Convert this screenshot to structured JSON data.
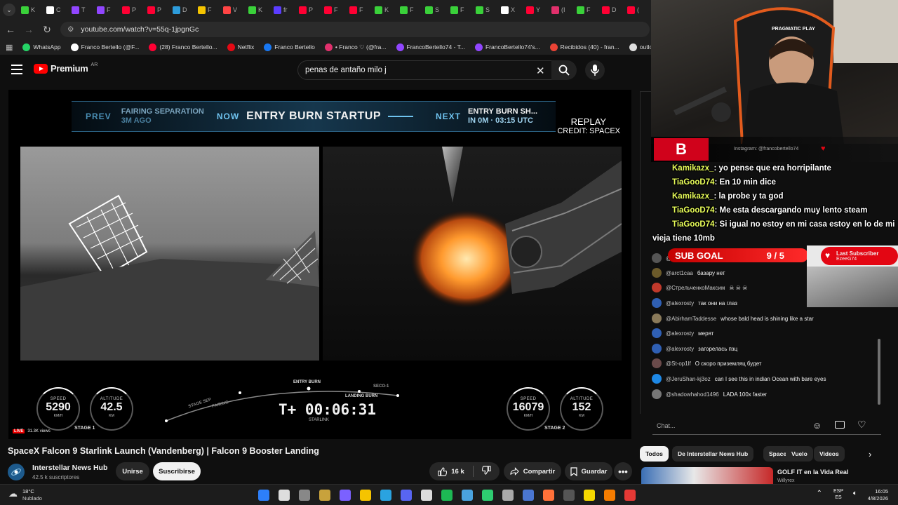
{
  "browser": {
    "tabs": [
      {
        "label": "K",
        "color": "#3ad13a"
      },
      {
        "label": "C",
        "color": "#ffffff"
      },
      {
        "label": "T",
        "color": "#9146ff"
      },
      {
        "label": "F",
        "color": "#9146ff"
      },
      {
        "label": "P",
        "color": "#ff0033"
      },
      {
        "label": "P",
        "color": "#ff0033"
      },
      {
        "label": "D",
        "color": "#2d9cdb"
      },
      {
        "label": "F",
        "color": "#f5c400"
      },
      {
        "label": "V",
        "color": "#ff4444"
      },
      {
        "label": "K",
        "color": "#3ad13a"
      },
      {
        "label": "fr",
        "color": "#5b3cff"
      },
      {
        "label": "P",
        "color": "#ff0033"
      },
      {
        "label": "F",
        "color": "#ff0033"
      },
      {
        "label": "F",
        "color": "#ff0033"
      },
      {
        "label": "K",
        "color": "#3ad13a"
      },
      {
        "label": "F",
        "color": "#3ad13a"
      },
      {
        "label": "S",
        "color": "#3ad13a"
      },
      {
        "label": "F",
        "color": "#3ad13a"
      },
      {
        "label": "S",
        "color": "#3ad13a"
      },
      {
        "label": "X",
        "color": "#ffffff"
      },
      {
        "label": "Y",
        "color": "#ff0033"
      },
      {
        "label": "(I",
        "color": "#e1306c"
      },
      {
        "label": "F",
        "color": "#3ad13a"
      },
      {
        "label": "D",
        "color": "#ff0033"
      },
      {
        "label": "(",
        "color": "#ff0033"
      }
    ],
    "url": "youtube.com/watch?v=55q-1jpgnGc",
    "bookmarks": [
      {
        "label": "WhatsApp",
        "color": "#25d366"
      },
      {
        "label": "Franco Bertello (@F...",
        "color": "#ffffff"
      },
      {
        "label": "(28) Franco Bertello...",
        "color": "#ff0033"
      },
      {
        "label": "Netflix",
        "color": "#e50914"
      },
      {
        "label": "Franco Bertello",
        "color": "#1877f2"
      },
      {
        "label": "• Franco ♡ (@fra...",
        "color": "#e1306c"
      },
      {
        "label": "FrancoBertello74 - T...",
        "color": "#9146ff"
      },
      {
        "label": "FrancoBertello74's...",
        "color": "#9146ff"
      },
      {
        "label": "Recibidos (40) - fran...",
        "color": "#ea4335"
      },
      {
        "label": "outlook",
        "color": "#dddddd"
      },
      {
        "label": "Alert",
        "color": "#3ad1a0"
      }
    ]
  },
  "youtube": {
    "brand": "Premium",
    "country": "AR",
    "search_query": "penas de antaño milo j",
    "video": {
      "timeline": {
        "prev_key": "PREV",
        "prev_event": "FAIRING SEPARATION",
        "prev_time": "3M AGO",
        "now_key": "NOW",
        "now_event": "ENTRY BURN STARTUP",
        "next_key": "NEXT",
        "next_event": "ENTRY BURN SH...",
        "next_time": "IN 0M · 03:15 UTC"
      },
      "replay": "REPLAY",
      "credit": "CREDIT: SPACEX",
      "stage1": {
        "speed": "5290",
        "altitude": "42.5",
        "speed_label": "SPEED",
        "altitude_label": "ALTITUDE",
        "speed_unit": "KM/H",
        "altitude_unit": "KM",
        "name": "STAGE 1"
      },
      "stage2": {
        "speed": "16079",
        "altitude": "152",
        "speed_label": "SPEED",
        "altitude_label": "ALTITUDE",
        "speed_unit": "KM/H",
        "altitude_unit": "KM",
        "name": "STAGE 2"
      },
      "timer": "T+ 00:06:31",
      "timer_label": "STARLINK",
      "events": [
        "ENTRY BURN",
        "LANDING BURN",
        "SECO-1",
        "STAGE SEP",
        "FAIRING"
      ],
      "live_label": "LIVE",
      "viewers": "31.3K views"
    },
    "title": "SpaceX Falcon 9 Starlink Launch (Vandenberg) | Falcon 9 Booster Landing",
    "channel": {
      "name": "Interstellar News Hub",
      "subs": "42.5 k suscriptores",
      "join": "Unirse",
      "subscribe": "Suscribirse"
    },
    "actions": {
      "likes": "16 k",
      "share": "Compartir",
      "save": "Guardar"
    },
    "chips": [
      "Todos",
      "De Interstellar News Hub",
      "SpaceX",
      "Vuelo",
      "Videos"
    ],
    "recommended": {
      "title": "GOLF IT en la Vida Real",
      "channel": "Willyrex"
    }
  },
  "chat": {
    "placeholder": "Chat...",
    "messages": [
      {
        "author": "@Franklinalex",
        "text": "так вопрос вновь - как они скоро",
        "color": "#555555"
      },
      {
        "author": "@arct1caa",
        "text": "базару нет",
        "color": "#6b5a2a"
      },
      {
        "author": "@СтрельченкоМаксим",
        "text": "☠ ☠ ☠",
        "color": "#c0392b"
      },
      {
        "author": "@alexrosty",
        "text": "так они на глаз",
        "color": "#2f5fb3"
      },
      {
        "author": "@AbirhamTaddesse",
        "text": "whose bald head is shining like a star",
        "color": "#8a7a5a"
      },
      {
        "author": "@alexrosty",
        "text": "мерят",
        "color": "#2f5fb3"
      },
      {
        "author": "@alexrosty",
        "text": "загорелась пзц",
        "color": "#2f5fb3"
      },
      {
        "author": "@St-op1lf",
        "text": "О скоро приземляц будет",
        "color": "#6a4a4a"
      },
      {
        "author": "@JeruShan-kj3oz",
        "text": "can I see this in indian Ocean with bare eyes",
        "color": "#1e88e5"
      },
      {
        "author": "@shadowhahod1496",
        "text": "LADA 100x faster",
        "color": "#777777"
      }
    ]
  },
  "stream": {
    "instagram": "Instagram: @francobertello74",
    "overlay_chat": [
      {
        "user": "Kamikazx_",
        "text": ": yo pense que era horripilante"
      },
      {
        "user": "TiaGooD74",
        "text": ": En 10 min dice"
      },
      {
        "user": "Kamikazx_",
        "text": ": la probe y ta god"
      },
      {
        "user": "TiaGooD74",
        "text": ": Me esta descargando muy lento steam"
      },
      {
        "user": "TiaGooD74",
        "text": ": Si igual no estoy en mi casa estoy en lo de mi"
      },
      {
        "user": "",
        "text": "vieja tiene 10mb"
      }
    ],
    "sub_goal_label": "SUB GOAL",
    "sub_goal_value": "9 / 5",
    "last_sub_label": "Last Subscriber",
    "last_sub_name": "EzeeG74",
    "sponsor": "PRAGMATIC PLAY"
  },
  "taskbar": {
    "temp": "18°C",
    "weather": "Nublado",
    "lang1": "ESP",
    "lang2": "ES",
    "time": "16:05",
    "date": "4/8/2026"
  },
  "colors": {
    "accent": "#ff0000",
    "live": "#e00000",
    "overlay_user": "#eaff5a",
    "subgoal": "#e30613"
  }
}
